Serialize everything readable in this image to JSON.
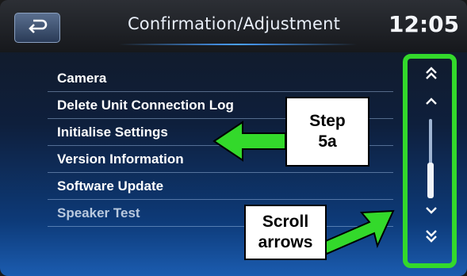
{
  "header": {
    "title": "Confirmation/Adjustment",
    "clock": "12:05",
    "back_icon": "back-return-icon"
  },
  "menu": {
    "items": [
      {
        "label": "Camera"
      },
      {
        "label": "Delete Unit Connection Log"
      },
      {
        "label": "Initialise Settings"
      },
      {
        "label": "Version Information"
      },
      {
        "label": "Software Update"
      },
      {
        "label": "Speaker Test"
      }
    ]
  },
  "scrollbar": {
    "page_up_icon": "double-chevron-up-icon",
    "up_icon": "chevron-up-icon",
    "down_icon": "chevron-down-icon",
    "page_down_icon": "double-chevron-down-icon"
  },
  "callouts": {
    "step_line1": "Step",
    "step_line2": "5a",
    "scroll_line1": "Scroll",
    "scroll_line2": "arrows"
  },
  "colors": {
    "highlight_green": "#33d92b",
    "accent_blue": "#4aa0ff"
  }
}
